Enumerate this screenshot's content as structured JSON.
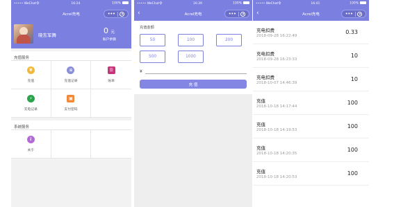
{
  "status": {
    "carrier": "••••• WeChat令",
    "battery": "100%"
  },
  "panel1": {
    "time": "16:24",
    "title": "Acrel充电",
    "user_name": "晓东军舞",
    "balance": "0",
    "balance_unit": "元",
    "balance_label": "账户余额",
    "section_recharge": "充值服务",
    "services": [
      {
        "label": "充值",
        "icon": "wallet-icon",
        "color": "#f0b93a"
      },
      {
        "label": "充值记录",
        "icon": "record-icon",
        "color": "#8a8fd8"
      },
      {
        "label": "账单",
        "icon": "bill-icon",
        "color": "#c9337a"
      },
      {
        "label": "充电记录",
        "icon": "lightning-icon",
        "color": "#2aa44a"
      },
      {
        "label": "支付密码",
        "icon": "lock-icon",
        "color": "#f08a3a"
      }
    ],
    "section_system": "系统服务",
    "system": [
      {
        "label": "关于",
        "icon": "info-icon",
        "color": "#b46ad6"
      }
    ]
  },
  "panel2": {
    "time": "16:39",
    "title": "Acrel充电",
    "amount_label": "充值金额",
    "amounts": [
      "50",
      "100",
      "200",
      "500",
      "1000"
    ],
    "currency_symbol": "¥",
    "button_label": "充 值"
  },
  "panel3": {
    "time": "16:41",
    "title": "Acrel充电",
    "records": [
      {
        "type": "充电扣费",
        "date": "2018-09-28 16:22:49",
        "amount": "0.33"
      },
      {
        "type": "充电扣费",
        "date": "2018-09-28 16:23:33",
        "amount": "10"
      },
      {
        "type": "充电扣费",
        "date": "2018-10-07 14:46:39",
        "amount": "10"
      },
      {
        "type": "充值",
        "date": "2018-10-18 14:17:44",
        "amount": "100"
      },
      {
        "type": "充值",
        "date": "2018-10-18 14:19:53",
        "amount": "100"
      },
      {
        "type": "充值",
        "date": "2018-10-18 14:20:35",
        "amount": "100"
      },
      {
        "type": "充值",
        "date": "2018-10-18 14:20:53",
        "amount": "100"
      }
    ]
  }
}
